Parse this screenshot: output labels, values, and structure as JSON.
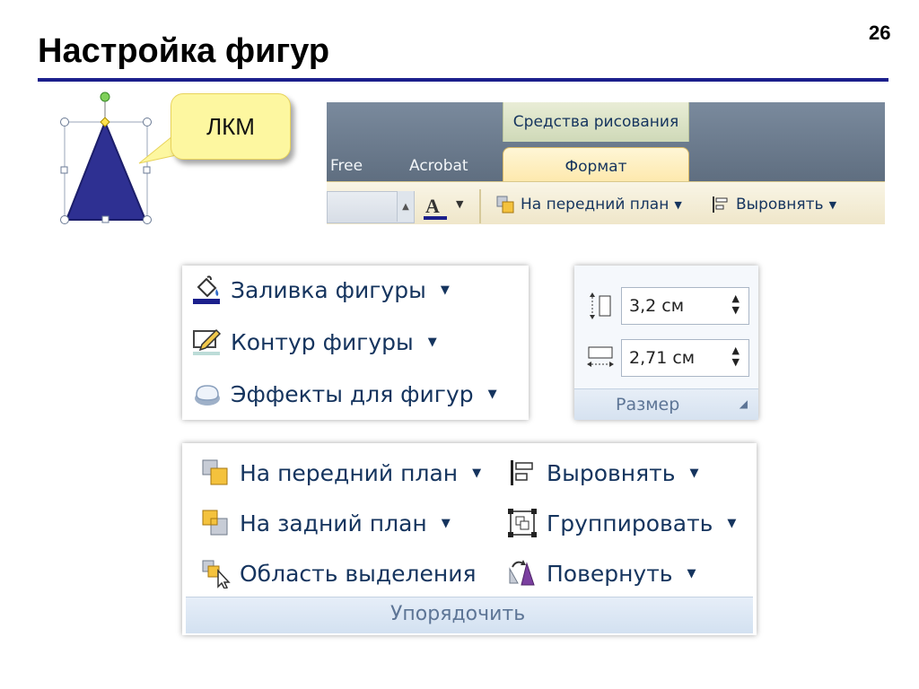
{
  "slide": {
    "title": "Настройка фигур",
    "number": "26",
    "callout_text": "ЛКМ"
  },
  "ribbon": {
    "context_tab": "Средства рисования",
    "tabs": [
      {
        "label": "Free"
      },
      {
        "label": "Acrobat"
      },
      {
        "label": "Формат",
        "active": true
      }
    ],
    "buttons": {
      "bring_forward": "На передний план",
      "align": "Выровнять"
    },
    "font_color_letter": "A"
  },
  "shape_styles": {
    "items": [
      {
        "label": "Заливка фигуры",
        "icon": "paint-bucket-icon"
      },
      {
        "label": "Контур фигуры",
        "icon": "pencil-outline-icon"
      },
      {
        "label": "Эффекты для фигур",
        "icon": "shape-effects-icon"
      }
    ]
  },
  "size": {
    "height_value": "3,2 см",
    "width_value": "2,71 см",
    "group_label": "Размер"
  },
  "arrange": {
    "left_items": [
      {
        "label": "На передний план",
        "icon": "bring-forward-icon",
        "dropdown": true
      },
      {
        "label": "На задний план",
        "icon": "send-backward-icon",
        "dropdown": true
      },
      {
        "label": "Область выделения",
        "icon": "selection-pane-icon",
        "dropdown": false
      }
    ],
    "right_items": [
      {
        "label": "Выровнять",
        "icon": "align-icon",
        "dropdown": true
      },
      {
        "label": "Группировать",
        "icon": "group-icon",
        "dropdown": true
      },
      {
        "label": "Повернуть",
        "icon": "rotate-icon",
        "dropdown": true
      }
    ],
    "group_label": "Упорядочить"
  },
  "colors": {
    "title_rule": "#1b1f8c",
    "triangle_fill": "#2e3092",
    "ribbon_text": "#15345e",
    "callout_fill": "#fdf7a0"
  }
}
